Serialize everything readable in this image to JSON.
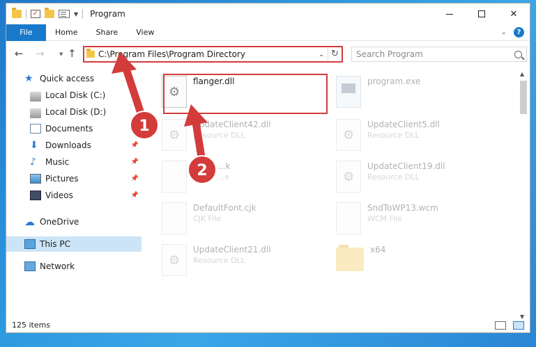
{
  "window": {
    "title": "Program"
  },
  "ribbon": {
    "tabs": [
      "File",
      "Home",
      "Share",
      "View"
    ]
  },
  "address": {
    "path": "C:\\Program Files\\Program Directory"
  },
  "search": {
    "placeholder": "Search Program"
  },
  "nav": {
    "items": [
      {
        "label": "Quick access",
        "icon": "star-icon"
      },
      {
        "label": "Local Disk (C:)",
        "icon": "disk-icon"
      },
      {
        "label": "Local Disk (D:)",
        "icon": "disk-icon"
      },
      {
        "label": "Documents",
        "icon": "documents-icon"
      },
      {
        "label": "Downloads",
        "icon": "downloads-icon",
        "pinned": true
      },
      {
        "label": "Music",
        "icon": "music-icon",
        "pinned": true
      },
      {
        "label": "Pictures",
        "icon": "pictures-icon",
        "pinned": true
      },
      {
        "label": "Videos",
        "icon": "videos-icon",
        "pinned": true
      },
      {
        "label": "OneDrive",
        "icon": "onedrive-icon"
      },
      {
        "label": "This PC",
        "icon": "this-pc-icon",
        "selected": true
      },
      {
        "label": "Network",
        "icon": "network-icon"
      }
    ]
  },
  "files": [
    {
      "name": "flanger.dll",
      "type": "",
      "icon": "dll-file-icon",
      "highlighted": true
    },
    {
      "name": "program.exe",
      "type": "",
      "icon": "exe-file-icon"
    },
    {
      "name": "UpdateClient42.dll",
      "type": "Resource DLL",
      "icon": "dll-file-icon"
    },
    {
      "name": "UpdateClient5.dll",
      "type": "Resource DLL",
      "icon": "dll-file-icon"
    },
    {
      "name": "...k",
      "type": "...e",
      "icon": "file-icon"
    },
    {
      "name": "UpdateClient19.dll",
      "type": "Resource DLL",
      "icon": "dll-file-icon"
    },
    {
      "name": "DefaultFont.cjk",
      "type": "CJK File",
      "icon": "file-icon"
    },
    {
      "name": "SndToWP13.wcm",
      "type": "WCM File",
      "icon": "file-icon"
    },
    {
      "name": "UpdateClient21.dll",
      "type": "Resource DLL",
      "icon": "dll-file-icon"
    },
    {
      "name": "x64",
      "type": "",
      "icon": "folder-icon"
    }
  ],
  "status": {
    "count": "125 items"
  },
  "annotations": {
    "step1": "1",
    "step2": "2",
    "color": "#d43b3b"
  }
}
